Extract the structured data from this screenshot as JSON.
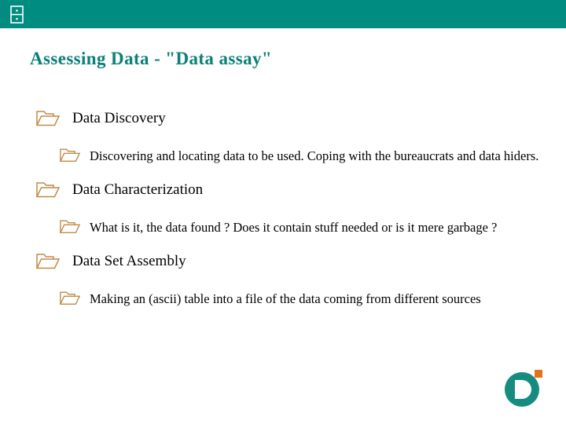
{
  "header": {
    "icon": "file-cabinet-icon",
    "bar_color": "#008C80"
  },
  "slide": {
    "title": "Assessing Data - \"Data assay\"",
    "title_color": "#0B8077",
    "bullet_icon": "folder-icon",
    "bullet_icon_color": "#C08A4A",
    "body_text_color": "#000000",
    "background_color": "#FFFFFF",
    "bullets": [
      {
        "level": 1,
        "text": "Data Discovery"
      },
      {
        "level": 2,
        "text": "Discovering and locating data to be used. Coping with the bureaucrats and data hiders."
      },
      {
        "level": 1,
        "text": "Data Characterization"
      },
      {
        "level": 2,
        "text": "What is it, the data found ? Does it contain stuff needed or is it mere garbage ?"
      },
      {
        "level": 1,
        "text": "Data Set Assembly"
      },
      {
        "level": 2,
        "text": "Making an (ascii) table into a file of the data coming from different sources"
      }
    ]
  },
  "logo": {
    "name": "d-circle-logo",
    "letter": "D",
    "circle_color": "#168C80",
    "accent_color": "#E2721B"
  }
}
